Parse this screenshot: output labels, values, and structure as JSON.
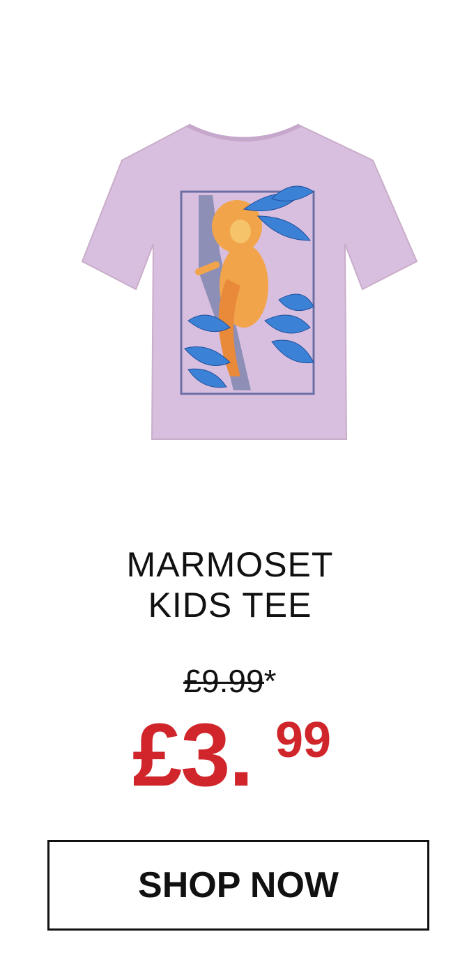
{
  "product": {
    "title_line1": "MARMOSET",
    "title_line2": "KIDS TEE",
    "old_price": "£9.99",
    "old_price_suffix": "*",
    "price_main": "£3.",
    "price_pence": "99",
    "cta_label": "SHOP NOW",
    "image_icon": "tshirt-marmoset-image"
  },
  "colors": {
    "shirt": "#d8bfe0",
    "price": "#d0252b",
    "leaf_blue": "#3b82d6",
    "marmoset_orange": "#f2a44a"
  }
}
